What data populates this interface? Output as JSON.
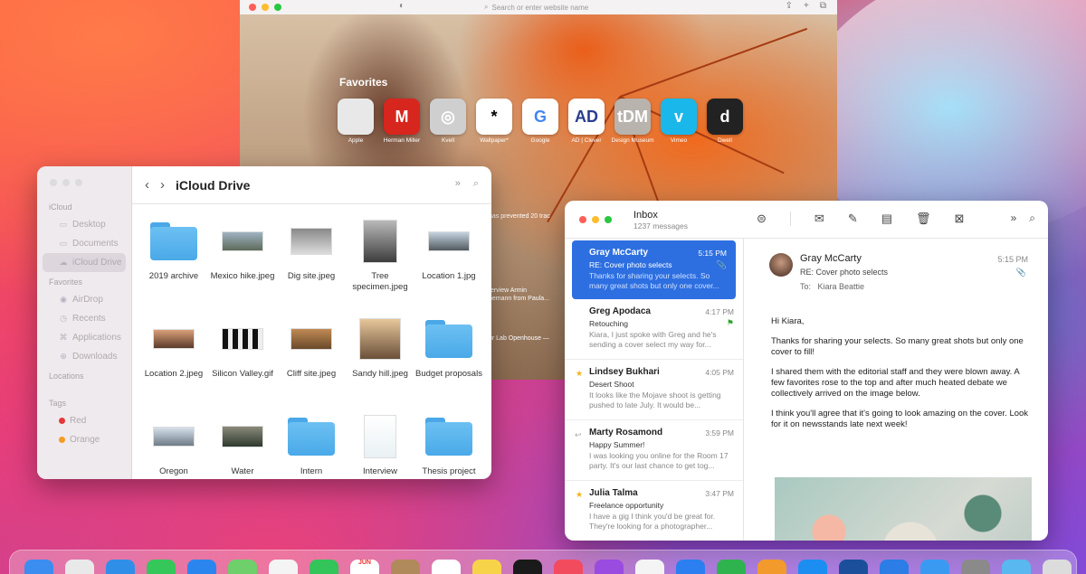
{
  "safari": {
    "address_placeholder": "Search or enter website name",
    "favorites_title": "Favorites",
    "favorites": [
      {
        "label": "Apple",
        "glyph": "",
        "bg": "#e8e8e8",
        "fg": "#666"
      },
      {
        "label": "Herman Miller",
        "glyph": "M",
        "bg": "#d7261e",
        "fg": "#fff"
      },
      {
        "label": "Kvell",
        "glyph": "◎",
        "bg": "#cfcfcf",
        "fg": "#fff"
      },
      {
        "label": "Wallpaper*",
        "glyph": "*",
        "bg": "#ffffff",
        "fg": "#000"
      },
      {
        "label": "Google",
        "glyph": "G",
        "bg": "#ffffff",
        "fg": "#4285f4"
      },
      {
        "label": "AD | Clever",
        "glyph": "AD",
        "bg": "#ffffff",
        "fg": "#2a3c8f"
      },
      {
        "label": "Design Museum",
        "glyph": "tDM",
        "bg": "#b9b3ad",
        "fg": "#fff"
      },
      {
        "label": "Vimeo",
        "glyph": "v",
        "bg": "#1ab7ea",
        "fg": "#fff"
      },
      {
        "label": "Dwell",
        "glyph": "d",
        "bg": "#222222",
        "fg": "#fff"
      }
    ],
    "news": [
      "has prevented 20 trac",
      "terview Armin",
      "nemann from Paula...",
      "ur Lab Openhouse —"
    ]
  },
  "finder": {
    "title": "iCloud Drive",
    "sections": [
      {
        "head": "iCloud",
        "items": [
          {
            "label": "Desktop",
            "icon": "▭"
          },
          {
            "label": "Documents",
            "icon": "▭"
          },
          {
            "label": "iCloud Drive",
            "icon": "☁",
            "active": true
          }
        ]
      },
      {
        "head": "Favorites",
        "items": [
          {
            "label": "AirDrop",
            "icon": "◉"
          },
          {
            "label": "Recents",
            "icon": "◷"
          },
          {
            "label": "Applications",
            "icon": "⌘"
          },
          {
            "label": "Downloads",
            "icon": "⊕"
          }
        ]
      },
      {
        "head": "Locations",
        "items": []
      },
      {
        "head": "Tags",
        "items": [
          {
            "label": "Red",
            "tag": "#e5383b"
          },
          {
            "label": "Orange",
            "tag": "#f59b22"
          }
        ]
      }
    ],
    "files": [
      {
        "name": "2019 archive",
        "kind": "folder"
      },
      {
        "name": "Mexico hike.jpeg",
        "kind": "photo",
        "w": 46,
        "h": 22,
        "bg": "linear-gradient(#9fb3c2,#5d6b5a)"
      },
      {
        "name": "Dig site.jpeg",
        "kind": "photo",
        "w": 46,
        "h": 30,
        "bg": "linear-gradient(#8a8a8a,#dcdcdc)"
      },
      {
        "name": "Tree specimen.jpeg",
        "kind": "photo",
        "w": 38,
        "h": 48,
        "bg": "linear-gradient(#b9b9b9,#3d3d3d)"
      },
      {
        "name": "Location 1.jpg",
        "kind": "photo",
        "w": 46,
        "h": 22,
        "bg": "linear-gradient(#c4d3df,#525a5e)"
      },
      {
        "name": "Location 2.jpeg",
        "kind": "photo",
        "w": 46,
        "h": 22,
        "bg": "linear-gradient(#d9a07a,#5a3b2a)"
      },
      {
        "name": "Silicon Valley.gif",
        "kind": "photo",
        "w": 46,
        "h": 24,
        "bg": "repeating-linear-gradient(90deg,#111 0 6px,#eee 6px 11px)"
      },
      {
        "name": "Cliff site.jpeg",
        "kind": "photo",
        "w": 46,
        "h": 24,
        "bg": "linear-gradient(#c08a55,#6a4a2a)"
      },
      {
        "name": "Sandy hill.jpeg",
        "kind": "photo",
        "w": 46,
        "h": 46,
        "bg": "linear-gradient(#e6c69a,#6a5039)"
      },
      {
        "name": "Budget proposals",
        "kind": "folder"
      },
      {
        "name": "Oregon",
        "kind": "photo",
        "w": 46,
        "h": 22,
        "bg": "linear-gradient(#d6e0ea,#6f7d88)"
      },
      {
        "name": "Water",
        "kind": "photo",
        "w": 46,
        "h": 24,
        "bg": "linear-gradient(#8a8a7a,#2f3a2f)"
      },
      {
        "name": "Intern",
        "kind": "folder"
      },
      {
        "name": "Interview",
        "kind": "photo",
        "w": 36,
        "h": 48,
        "bg": "linear-gradient(#ffffff,#e9f1f4)"
      },
      {
        "name": "Thesis project",
        "kind": "folder"
      }
    ]
  },
  "mail": {
    "title": "Inbox",
    "count": "1237 messages",
    "messages": [
      {
        "from": "Gray McCarty",
        "time": "5:15 PM",
        "subject": "RE: Cover photo selects",
        "preview": "Thanks for sharing your selects. So many great shots but only one cover...",
        "selected": true,
        "clip": true
      },
      {
        "from": "Greg Apodaca",
        "time": "4:17 PM",
        "subject": "Retouching",
        "preview": "Kiara, I just spoke with Greg and he's sending a cover select my way for...",
        "flag": true
      },
      {
        "from": "Lindsey Bukhari",
        "time": "4:05 PM",
        "subject": "Desert Shoot",
        "preview": "It looks like the Mojave shoot is getting pushed to late July. It would be...",
        "star": true
      },
      {
        "from": "Marty Rosamond",
        "time": "3:59 PM",
        "subject": "Happy Summer!",
        "preview": "I was looking you online for the Room 17 party. It's our last chance to get tog...",
        "reply": true
      },
      {
        "from": "Julia Talma",
        "time": "3:47 PM",
        "subject": "Freelance opportunity",
        "preview": "I have a gig I think you'd be great for. They're looking for a photographer...",
        "star": true
      }
    ],
    "reading": {
      "from": "Gray McCarty",
      "subject": "RE: Cover photo selects",
      "to_label": "To:",
      "to": "Kiara Beattie",
      "time": "5:15 PM",
      "greeting": "Hi Kiara,",
      "p1": "Thanks for sharing your selects. So many great shots but only one cover to fill!",
      "p2": "I shared them with the editorial staff and they were blown away. A few favorites rose to the top and after much heated debate we collectively arrived on the image below.",
      "p3": "I think you'll agree that it's going to look amazing on the cover. Look for it on newsstands late next week!"
    }
  },
  "dock": [
    {
      "name": "finder",
      "bg": "#3b8df0"
    },
    {
      "name": "launchpad",
      "bg": "#e9e9e9"
    },
    {
      "name": "safari",
      "bg": "#2f8fe8"
    },
    {
      "name": "messages",
      "bg": "#35c759"
    },
    {
      "name": "mail",
      "bg": "#2a86ee"
    },
    {
      "name": "maps",
      "bg": "#6fcf6a"
    },
    {
      "name": "photos",
      "bg": "#f4f4f4"
    },
    {
      "name": "facetime",
      "bg": "#33c45a"
    },
    {
      "name": "calendar",
      "bg": "#ffffff"
    },
    {
      "name": "contacts",
      "bg": "#b08a5a"
    },
    {
      "name": "reminders",
      "bg": "#ffffff"
    },
    {
      "name": "notes",
      "bg": "#f7d34a"
    },
    {
      "name": "tv",
      "bg": "#1a1a1a"
    },
    {
      "name": "music",
      "bg": "#f24b5e"
    },
    {
      "name": "podcasts",
      "bg": "#9a4be0"
    },
    {
      "name": "news",
      "bg": "#f4f4f4"
    },
    {
      "name": "keynote",
      "bg": "#2b7ff0"
    },
    {
      "name": "numbers",
      "bg": "#2fb34f"
    },
    {
      "name": "pages",
      "bg": "#f29a2b"
    },
    {
      "name": "app-store",
      "bg": "#1c8ef2"
    },
    {
      "name": "xcode",
      "bg": "#1b4f9c"
    },
    {
      "name": "instruments",
      "bg": "#2c7de6"
    },
    {
      "name": "testflight",
      "bg": "#3a9af2"
    },
    {
      "name": "system-preferences",
      "bg": "#8a8a8a"
    },
    {
      "name": "downloads",
      "bg": "#59b8f0"
    },
    {
      "name": "trash",
      "bg": "#dcdcdc"
    }
  ],
  "dock_calendar_month": "JUN"
}
